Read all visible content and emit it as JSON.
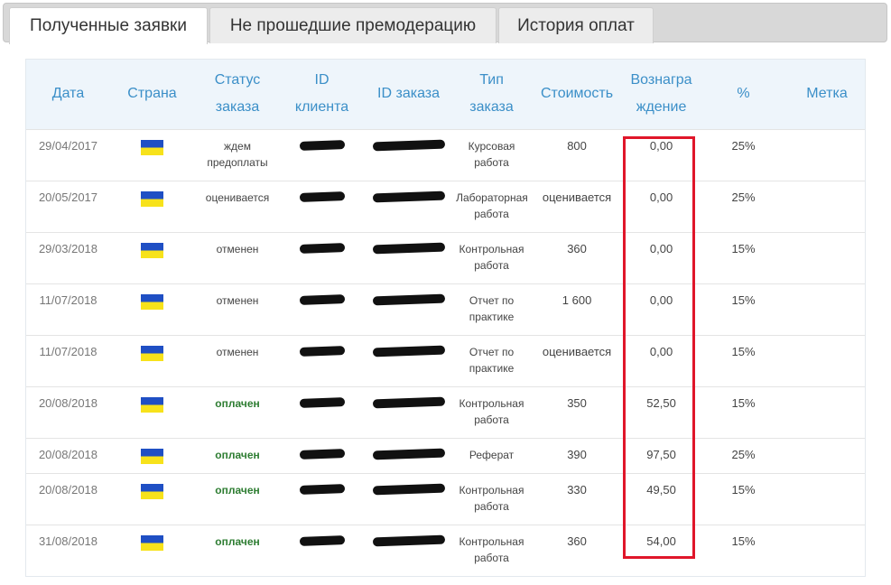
{
  "tabs": [
    {
      "label": "Полученные заявки",
      "active": true
    },
    {
      "label": "Не прошедшие премодерацию",
      "active": false
    },
    {
      "label": "История оплат",
      "active": false
    }
  ],
  "table": {
    "headers": {
      "date": "Дата",
      "country": "Страна",
      "status": "Статус заказа",
      "client_id": "ID клиента",
      "order_id": "ID заказа",
      "type": "Тип заказа",
      "cost": "Стоимость",
      "reward": "Вознаграждение",
      "percent": "%",
      "tag": "Метка"
    },
    "header_lines": {
      "status": [
        "Статус",
        "заказа"
      ],
      "client_id": [
        "ID",
        "клиента"
      ],
      "type": [
        "Тип",
        "заказа"
      ],
      "reward": [
        "Вознагра",
        "ждение"
      ]
    },
    "rows": [
      {
        "date": "29/04/2017",
        "status": "ждем предоплаты",
        "type": "Курсовая работа",
        "cost": "800",
        "reward": "0,00",
        "percent": "25%",
        "paid": false
      },
      {
        "date": "20/05/2017",
        "status": "оценивается",
        "type": "Лабораторная работа",
        "cost": "оценивается",
        "reward": "0,00",
        "percent": "25%",
        "paid": false
      },
      {
        "date": "29/03/2018",
        "status": "отменен",
        "type": "Контрольная работа",
        "cost": "360",
        "reward": "0,00",
        "percent": "15%",
        "paid": false
      },
      {
        "date": "11/07/2018",
        "status": "отменен",
        "type": "Отчет по практике",
        "cost": "1 600",
        "reward": "0,00",
        "percent": "15%",
        "paid": false
      },
      {
        "date": "11/07/2018",
        "status": "отменен",
        "type": "Отчет по практике",
        "cost": "оценивается",
        "reward": "0,00",
        "percent": "15%",
        "paid": false
      },
      {
        "date": "20/08/2018",
        "status": "оплачен",
        "type": "Контрольная работа",
        "cost": "350",
        "reward": "52,50",
        "percent": "15%",
        "paid": true
      },
      {
        "date": "20/08/2018",
        "status": "оплачен",
        "type": "Реферат",
        "cost": "390",
        "reward": "97,50",
        "percent": "25%",
        "paid": true
      },
      {
        "date": "20/08/2018",
        "status": "оплачен",
        "type": "Контрольная работа",
        "cost": "330",
        "reward": "49,50",
        "percent": "15%",
        "paid": true
      },
      {
        "date": "31/08/2018",
        "status": "оплачен",
        "type": "Контрольная работа",
        "cost": "360",
        "reward": "54,00",
        "percent": "15%",
        "paid": true
      }
    ]
  },
  "colors": {
    "header_text": "#3b8fc8",
    "paid_status": "#2e7d32",
    "highlight": "#e0162a",
    "flag_blue": "#1f4fc4",
    "flag_yellow": "#f7e21b"
  },
  "icons": {
    "country_flag": "ukraine-flag-icon"
  }
}
